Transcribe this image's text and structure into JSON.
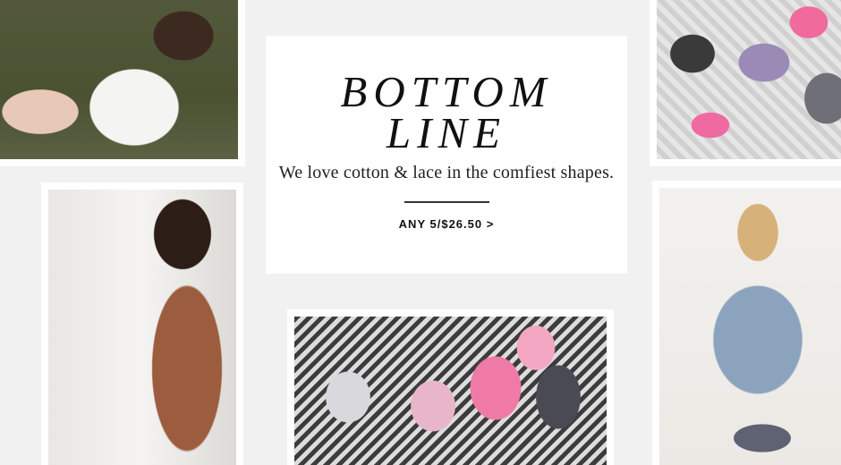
{
  "promo": {
    "title_line1": "BOTTOM",
    "title_line2": "LINE",
    "subtitle": "We love cotton & lace in the comfiest shapes.",
    "cta_label": "ANY 5/$26.50 >"
  },
  "colors": {
    "background": "#f1f1f1",
    "card": "#ffffff",
    "text": "#111111"
  }
}
